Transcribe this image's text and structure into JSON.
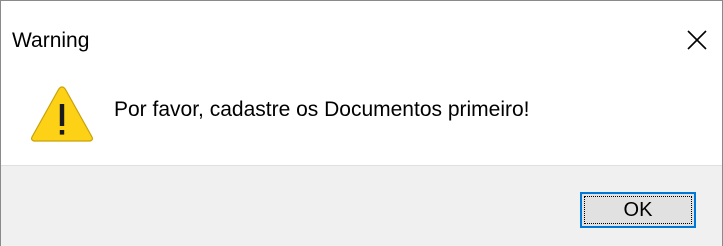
{
  "window": {
    "title": "Warning"
  },
  "icons": {
    "close": "close-icon",
    "warning": "warning-icon"
  },
  "content": {
    "message": "Por favor, cadastre os Documentos primeiro!"
  },
  "buttons": {
    "ok_label": "OK"
  },
  "colors": {
    "warning_fill": "#fcd116",
    "focus_border": "#0078d7",
    "footer_bg": "#f0f0f0"
  }
}
